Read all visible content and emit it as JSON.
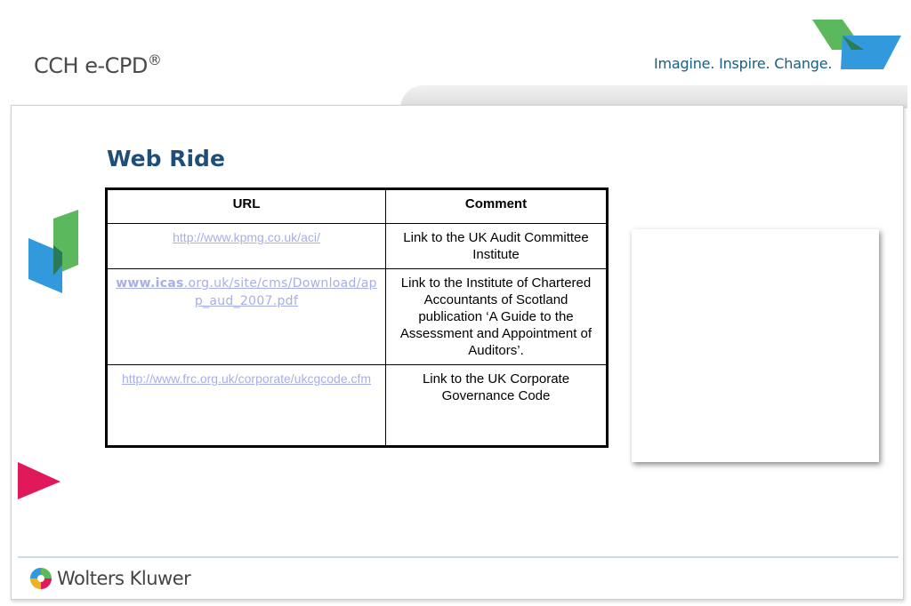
{
  "header": {
    "brand": "CCH e-CPD",
    "brand_mark": "®",
    "tagline": "Imagine. Inspire. Change."
  },
  "page": {
    "title": "Web Ride"
  },
  "table": {
    "columns": [
      "URL",
      "Comment"
    ],
    "rows": [
      {
        "url": "http://www.kpmg.co.uk/aci/",
        "comment": "Link to the UK Audit Committee Institute"
      },
      {
        "url_bold": "www.icas",
        "url_rest": ".org.uk/site/cms/Download/app_aud_2007.pdf",
        "comment": "Link to the Institute of Chartered Accountants of Scotland publication ‘A Guide to the Assessment and Appointment of Auditors’."
      },
      {
        "url": "http://www.frc.org.uk/corporate/ukcgcode.cfm",
        "comment": "Link to the UK Corporate Governance Code"
      }
    ]
  },
  "footer": {
    "logo_text": "Wolters Kluwer"
  },
  "colors": {
    "title": "#1f4e79",
    "link": "#a7aee8",
    "accent_green": "#4caf50",
    "accent_blue": "#2196f3",
    "accent_pink": "#e0195a"
  }
}
